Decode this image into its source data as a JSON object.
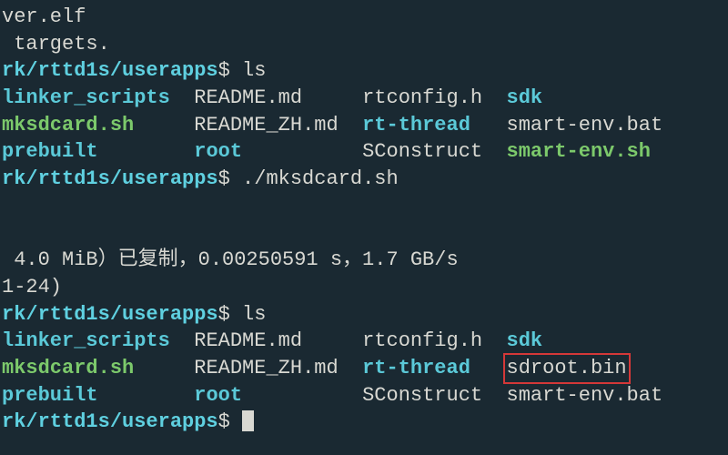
{
  "lines": {
    "l1": "ver.elf",
    "l2": " targets.",
    "prompt1_path": "rk/rttd1s/userapps",
    "prompt_sigil": "$",
    "cmd_ls1": " ls",
    "ls1": {
      "c1a": "linker_scripts",
      "c1b": "mksdcard.sh",
      "c1c": "prebuilt",
      "c2a": "README.md",
      "c2b": "README_ZH.md",
      "c2c": "root",
      "c3a": "rtconfig.h",
      "c3b": "rt-thread",
      "c3c": "SConstruct",
      "c4a": "sdk",
      "c4b": "smart-env.bat",
      "c4c": "smart-env.sh"
    },
    "cmd_mksd": " ./mksdcard.sh",
    "dd_out": " 4.0 MiB）已复制，0.00250591 s，1.7 GB/s",
    "dd_out2": "1-24)",
    "cmd_ls2": " ls",
    "ls2": {
      "c1a": "linker_scripts",
      "c1b": "mksdcard.sh",
      "c1c": "prebuilt",
      "c2a": "README.md",
      "c2b": "README_ZH.md",
      "c2c": "root",
      "c3a": "rtconfig.h",
      "c3b": "rt-thread",
      "c3c": "SConstruct",
      "c4a": "sdk",
      "c4b": "sdroot.bin",
      "c4c": "smart-env.bat"
    }
  }
}
